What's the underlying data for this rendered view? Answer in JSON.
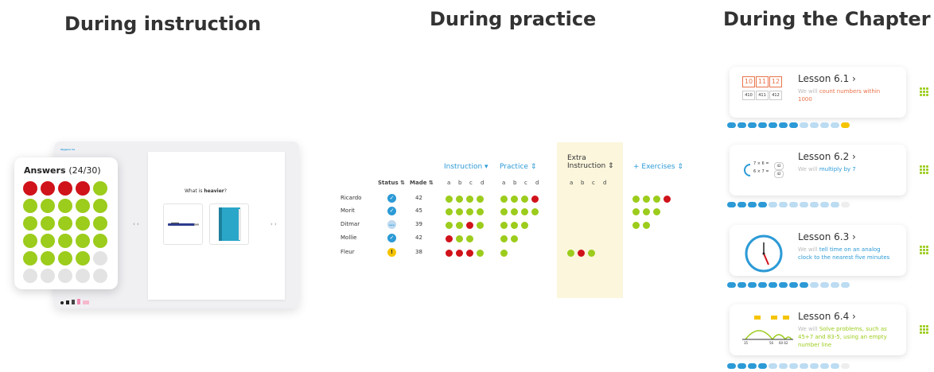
{
  "titles": {
    "instruction": "During instruction",
    "practice": "During practice",
    "chapter": "During the Chapter"
  },
  "instruction_panel": {
    "answers_label": "Answers",
    "answers_count": "(24/30)",
    "answer_dots": [
      "red",
      "red",
      "red",
      "red",
      "green",
      "green",
      "green",
      "green",
      "green",
      "green",
      "green",
      "green",
      "green",
      "green",
      "green",
      "green",
      "green",
      "green",
      "green",
      "green",
      "green",
      "green",
      "green",
      "green",
      "grey",
      "grey",
      "grey",
      "grey",
      "grey",
      "grey"
    ],
    "grey_dot_labels": [
      "",
      "",
      "",
      "",
      "",
      ""
    ],
    "slide_header": "Opgave 1a",
    "slide_question_prefix": "What is ",
    "slide_question_bold": "heavier",
    "slide_question_suffix": "?",
    "prev_arrow": "‹ ‹",
    "next_arrow": "› ›",
    "colors": {
      "green": "#9ccc1c",
      "red": "#d0121a",
      "book": "#2aa6c8"
    }
  },
  "practice_panel": {
    "columns": {
      "status": "Status",
      "made": "Made",
      "instruction": "Instruction",
      "practice": "Practice",
      "extra_instruction_line1": "Extra",
      "extra_instruction_line2": "Instruction",
      "exercises": "+ Exercises"
    },
    "sub_letters": [
      "a",
      "b",
      "c",
      "d"
    ],
    "students": [
      {
        "name": "Ricardo",
        "status": "done",
        "made": "42",
        "instruction": [
          "g",
          "g",
          "g",
          "g"
        ],
        "practice": [
          "g",
          "g",
          "g",
          "r"
        ],
        "extra": [],
        "exercises": [
          "g",
          "g",
          "g",
          "r"
        ]
      },
      {
        "name": "Morit",
        "status": "done",
        "made": "45",
        "instruction": [
          "g",
          "g",
          "g",
          "g"
        ],
        "practice": [
          "g",
          "g",
          "g",
          "g"
        ],
        "extra": [],
        "exercises": [
          "g",
          "g",
          "g"
        ]
      },
      {
        "name": "Ditmar",
        "status": "busy",
        "made": "39",
        "instruction": [
          "g",
          "g",
          "r",
          "g"
        ],
        "practice": [
          "g",
          "g",
          "g"
        ],
        "extra": [],
        "exercises": [
          "g",
          "g"
        ]
      },
      {
        "name": "Mollie",
        "status": "done",
        "made": "42",
        "instruction": [
          "r",
          "g",
          "g"
        ],
        "practice": [
          "g",
          "g"
        ],
        "extra": [],
        "exercises": []
      },
      {
        "name": "Fleur",
        "status": "warn",
        "made": "38",
        "instruction": [
          "r",
          "r",
          "r",
          "g"
        ],
        "practice": [
          "g"
        ],
        "extra": [
          "g",
          "r",
          "g"
        ],
        "exercises": []
      }
    ]
  },
  "chapter_panel": {
    "lessons": [
      {
        "title": "Lesson 6.1 ›",
        "desc_lead": "We will ",
        "desc_highlight": "count numbers within 1000",
        "highlight_color": "#e8734a",
        "numbers_top": [
          "10",
          "11",
          "12"
        ],
        "numbers_bottom": [
          "410",
          "411",
          "412"
        ],
        "pills": [
          "blue",
          "blue",
          "blue",
          "blue",
          "blue",
          "blue",
          "blue",
          "lblue",
          "lblue",
          "lblue",
          "lblue",
          "yel"
        ]
      },
      {
        "title": "Lesson 6.2 ›",
        "desc_lead": "We will ",
        "desc_highlight": "multiply by 7",
        "highlight_color": "#2c9ad6",
        "eq1": "7 × 6 =",
        "eq2": "6 × 7 =",
        "ans": "42",
        "pills": [
          "blue",
          "blue",
          "blue",
          "blue",
          "lblue",
          "lblue",
          "lblue",
          "lblue",
          "lblue",
          "lblue",
          "lblue",
          "faint"
        ]
      },
      {
        "title": "Lesson 6.3 ›",
        "desc_lead": "We will ",
        "desc_highlight": "tell time on an analog clock to the nearest five minutes",
        "highlight_color": "#2c9ad6",
        "pills": [
          "blue",
          "blue",
          "blue",
          "blue",
          "blue",
          "blue",
          "blue",
          "blue",
          "lblue",
          "lblue",
          "lblue",
          "lblue"
        ]
      },
      {
        "title": "Lesson 6.4 ›",
        "desc_lead": "We will ",
        "desc_highlight": "Solve problems, such as 45+7 and 83-5, using an empty number line",
        "highlight_color": "#9ccc1c",
        "nl_labels": [
          "35",
          "56",
          "60 62"
        ],
        "pills": [
          "blue",
          "blue",
          "blue",
          "blue",
          "lblue",
          "lblue",
          "lblue",
          "lblue",
          "lblue",
          "lblue",
          "lblue",
          "faint"
        ]
      }
    ]
  }
}
